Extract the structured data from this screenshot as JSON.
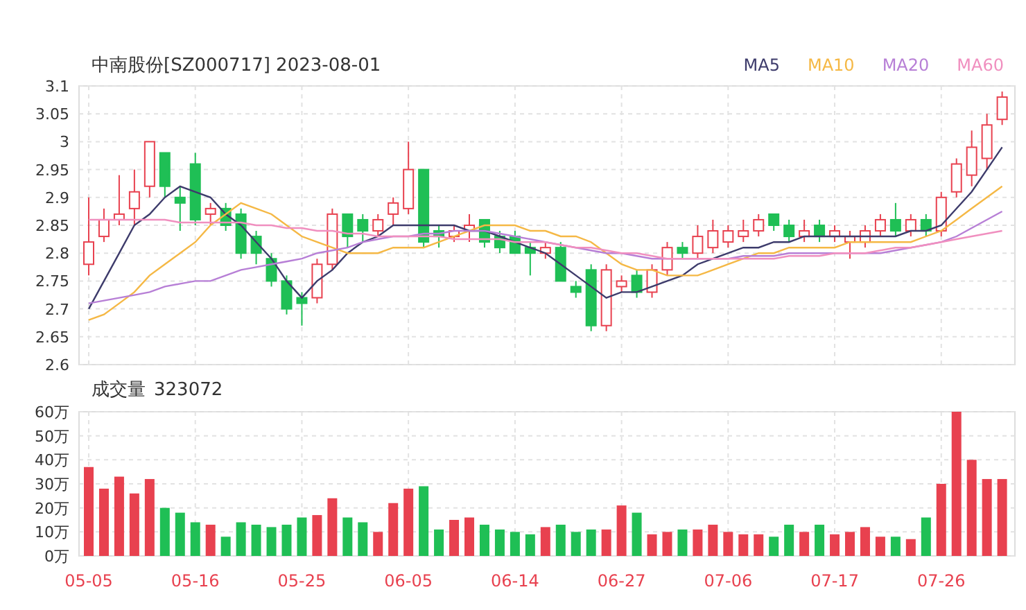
{
  "header": {
    "title": "中南股份[SZ000717] 2023-08-01"
  },
  "price_chart": {
    "chart_data": {
      "type": "candlestick",
      "grid": true,
      "ylim": [
        2.6,
        3.1
      ],
      "yticks": [
        2.6,
        2.65,
        2.7,
        2.75,
        2.8,
        2.85,
        2.9,
        2.95,
        3,
        3.05,
        3.1
      ],
      "ohlc": [
        [
          2.78,
          2.9,
          2.76,
          2.82
        ],
        [
          2.83,
          2.88,
          2.82,
          2.86
        ],
        [
          2.86,
          2.94,
          2.85,
          2.87
        ],
        [
          2.88,
          2.95,
          2.85,
          2.91
        ],
        [
          2.92,
          3.0,
          2.9,
          3.0
        ],
        [
          2.98,
          2.98,
          2.9,
          2.92
        ],
        [
          2.9,
          2.92,
          2.84,
          2.89
        ],
        [
          2.96,
          2.98,
          2.85,
          2.86
        ],
        [
          2.87,
          2.89,
          2.85,
          2.88
        ],
        [
          2.88,
          2.89,
          2.84,
          2.85
        ],
        [
          2.87,
          2.88,
          2.79,
          2.8
        ],
        [
          2.83,
          2.84,
          2.78,
          2.8
        ],
        [
          2.79,
          2.8,
          2.74,
          2.75
        ],
        [
          2.75,
          2.76,
          2.69,
          2.7
        ],
        [
          2.72,
          2.73,
          2.67,
          2.71
        ],
        [
          2.72,
          2.79,
          2.71,
          2.78
        ],
        [
          2.78,
          2.88,
          2.77,
          2.87
        ],
        [
          2.87,
          2.87,
          2.81,
          2.83
        ],
        [
          2.86,
          2.87,
          2.82,
          2.84
        ],
        [
          2.84,
          2.87,
          2.83,
          2.86
        ],
        [
          2.87,
          2.9,
          2.85,
          2.89
        ],
        [
          2.88,
          3.0,
          2.87,
          2.95
        ],
        [
          2.95,
          2.95,
          2.81,
          2.82
        ],
        [
          2.84,
          2.85,
          2.81,
          2.83
        ],
        [
          2.83,
          2.85,
          2.82,
          2.84
        ],
        [
          2.84,
          2.87,
          2.82,
          2.85
        ],
        [
          2.86,
          2.86,
          2.81,
          2.82
        ],
        [
          2.83,
          2.84,
          2.8,
          2.81
        ],
        [
          2.83,
          2.84,
          2.8,
          2.8
        ],
        [
          2.81,
          2.82,
          2.76,
          2.8
        ],
        [
          2.8,
          2.82,
          2.79,
          2.81
        ],
        [
          2.81,
          2.82,
          2.75,
          2.75
        ],
        [
          2.74,
          2.75,
          2.72,
          2.73
        ],
        [
          2.77,
          2.78,
          2.66,
          2.67
        ],
        [
          2.67,
          2.78,
          2.66,
          2.77
        ],
        [
          2.74,
          2.76,
          2.73,
          2.75
        ],
        [
          2.76,
          2.77,
          2.72,
          2.73
        ],
        [
          2.73,
          2.78,
          2.72,
          2.77
        ],
        [
          2.77,
          2.82,
          2.76,
          2.81
        ],
        [
          2.81,
          2.82,
          2.79,
          2.8
        ],
        [
          2.8,
          2.85,
          2.79,
          2.83
        ],
        [
          2.81,
          2.86,
          2.8,
          2.84
        ],
        [
          2.82,
          2.85,
          2.81,
          2.84
        ],
        [
          2.83,
          2.86,
          2.82,
          2.84
        ],
        [
          2.84,
          2.87,
          2.83,
          2.86
        ],
        [
          2.87,
          2.87,
          2.84,
          2.85
        ],
        [
          2.85,
          2.86,
          2.82,
          2.83
        ],
        [
          2.83,
          2.86,
          2.82,
          2.84
        ],
        [
          2.85,
          2.86,
          2.82,
          2.83
        ],
        [
          2.83,
          2.85,
          2.82,
          2.84
        ],
        [
          2.82,
          2.84,
          2.79,
          2.83
        ],
        [
          2.82,
          2.85,
          2.81,
          2.84
        ],
        [
          2.84,
          2.87,
          2.83,
          2.86
        ],
        [
          2.86,
          2.89,
          2.83,
          2.84
        ],
        [
          2.84,
          2.87,
          2.83,
          2.86
        ],
        [
          2.86,
          2.87,
          2.83,
          2.84
        ],
        [
          2.84,
          2.91,
          2.83,
          2.9
        ],
        [
          2.91,
          2.97,
          2.9,
          2.96
        ],
        [
          2.94,
          3.02,
          2.92,
          2.99
        ],
        [
          2.97,
          3.05,
          2.95,
          3.03
        ],
        [
          3.04,
          3.09,
          3.03,
          3.08
        ]
      ],
      "series": [
        {
          "name": "MA5",
          "type": "line",
          "color": "#3d3b6b",
          "values": [
            2.7,
            2.75,
            2.8,
            2.85,
            2.87,
            2.9,
            2.92,
            2.91,
            2.9,
            2.87,
            2.85,
            2.82,
            2.79,
            2.75,
            2.72,
            2.75,
            2.77,
            2.8,
            2.82,
            2.83,
            2.85,
            2.85,
            2.85,
            2.85,
            2.85,
            2.84,
            2.84,
            2.83,
            2.82,
            2.81,
            2.8,
            2.78,
            2.76,
            2.74,
            2.72,
            2.73,
            2.73,
            2.74,
            2.75,
            2.76,
            2.78,
            2.79,
            2.8,
            2.81,
            2.81,
            2.82,
            2.82,
            2.83,
            2.83,
            2.83,
            2.83,
            2.83,
            2.83,
            2.83,
            2.84,
            2.84,
            2.85,
            2.88,
            2.91,
            2.95,
            2.99
          ]
        },
        {
          "name": "MA10",
          "type": "line",
          "color": "#f5b845",
          "values": [
            2.68,
            2.69,
            2.71,
            2.73,
            2.76,
            2.78,
            2.8,
            2.82,
            2.85,
            2.87,
            2.89,
            2.88,
            2.87,
            2.85,
            2.83,
            2.82,
            2.81,
            2.8,
            2.8,
            2.8,
            2.81,
            2.81,
            2.81,
            2.82,
            2.83,
            2.84,
            2.85,
            2.85,
            2.85,
            2.84,
            2.84,
            2.83,
            2.83,
            2.82,
            2.8,
            2.78,
            2.77,
            2.77,
            2.76,
            2.76,
            2.76,
            2.77,
            2.78,
            2.79,
            2.8,
            2.8,
            2.81,
            2.81,
            2.81,
            2.81,
            2.82,
            2.82,
            2.82,
            2.82,
            2.82,
            2.83,
            2.84,
            2.86,
            2.88,
            2.9,
            2.92
          ]
        },
        {
          "name": "MA20",
          "type": "line",
          "color": "#b77fd6",
          "values": [
            2.71,
            2.715,
            2.72,
            2.725,
            2.73,
            2.74,
            2.745,
            2.75,
            2.75,
            2.76,
            2.77,
            2.775,
            2.78,
            2.785,
            2.79,
            2.8,
            2.805,
            2.81,
            2.82,
            2.825,
            2.83,
            2.83,
            2.835,
            2.835,
            2.84,
            2.84,
            2.84,
            2.835,
            2.83,
            2.825,
            2.82,
            2.815,
            2.81,
            2.805,
            2.8,
            2.8,
            2.795,
            2.79,
            2.79,
            2.79,
            2.79,
            2.79,
            2.79,
            2.795,
            2.795,
            2.795,
            2.8,
            2.8,
            2.8,
            2.8,
            2.8,
            2.8,
            2.8,
            2.805,
            2.81,
            2.815,
            2.82,
            2.83,
            2.845,
            2.86,
            2.875
          ]
        },
        {
          "name": "MA60",
          "type": "line",
          "color": "#f08fbf",
          "values": [
            2.86,
            2.86,
            2.86,
            2.86,
            2.86,
            2.86,
            2.855,
            2.855,
            2.855,
            2.855,
            2.855,
            2.85,
            2.85,
            2.845,
            2.845,
            2.84,
            2.84,
            2.835,
            2.835,
            2.83,
            2.83,
            2.83,
            2.83,
            2.83,
            2.825,
            2.825,
            2.825,
            2.825,
            2.82,
            2.82,
            2.82,
            2.815,
            2.81,
            2.81,
            2.805,
            2.8,
            2.8,
            2.795,
            2.79,
            2.79,
            2.79,
            2.79,
            2.79,
            2.79,
            2.79,
            2.79,
            2.795,
            2.795,
            2.795,
            2.8,
            2.8,
            2.8,
            2.805,
            2.81,
            2.81,
            2.815,
            2.82,
            2.825,
            2.83,
            2.835,
            2.84
          ]
        }
      ]
    }
  },
  "volume_chart": {
    "label": "成交量",
    "value": "323072",
    "chart_data": {
      "type": "bar",
      "grid": true,
      "ylim": [
        0,
        60
      ],
      "categories": [
        "05-05",
        null,
        null,
        null,
        null,
        null,
        null,
        "05-16",
        null,
        null,
        null,
        null,
        null,
        null,
        "05-25",
        null,
        null,
        null,
        null,
        null,
        null,
        "06-05",
        null,
        null,
        null,
        null,
        null,
        null,
        "06-14",
        null,
        null,
        null,
        null,
        null,
        null,
        "06-27",
        null,
        null,
        null,
        null,
        null,
        null,
        "07-06",
        null,
        null,
        null,
        null,
        null,
        null,
        "07-17",
        null,
        null,
        null,
        null,
        null,
        null,
        "07-26",
        null,
        null,
        null,
        null
      ],
      "yticks": [
        {
          "value": 0,
          "label": "0万"
        },
        {
          "value": 10,
          "label": "10万"
        },
        {
          "value": 20,
          "label": "20万"
        },
        {
          "value": 30,
          "label": "30万"
        },
        {
          "value": 40,
          "label": "40万"
        },
        {
          "value": 50,
          "label": "50万"
        },
        {
          "value": 60,
          "label": "60万"
        }
      ],
      "values": [
        37,
        28,
        33,
        26,
        32,
        20,
        18,
        14,
        13,
        8,
        14,
        13,
        12,
        13,
        16,
        17,
        24,
        16,
        14,
        10,
        22,
        28,
        29,
        11,
        15,
        16,
        13,
        11,
        10,
        9,
        12,
        13,
        10,
        11,
        11,
        21,
        18,
        9,
        10,
        11,
        11,
        13,
        10,
        9,
        9,
        8,
        13,
        10,
        13,
        9,
        10,
        12,
        8,
        8,
        7,
        16,
        30,
        60,
        40,
        32,
        32
      ]
    }
  }
}
